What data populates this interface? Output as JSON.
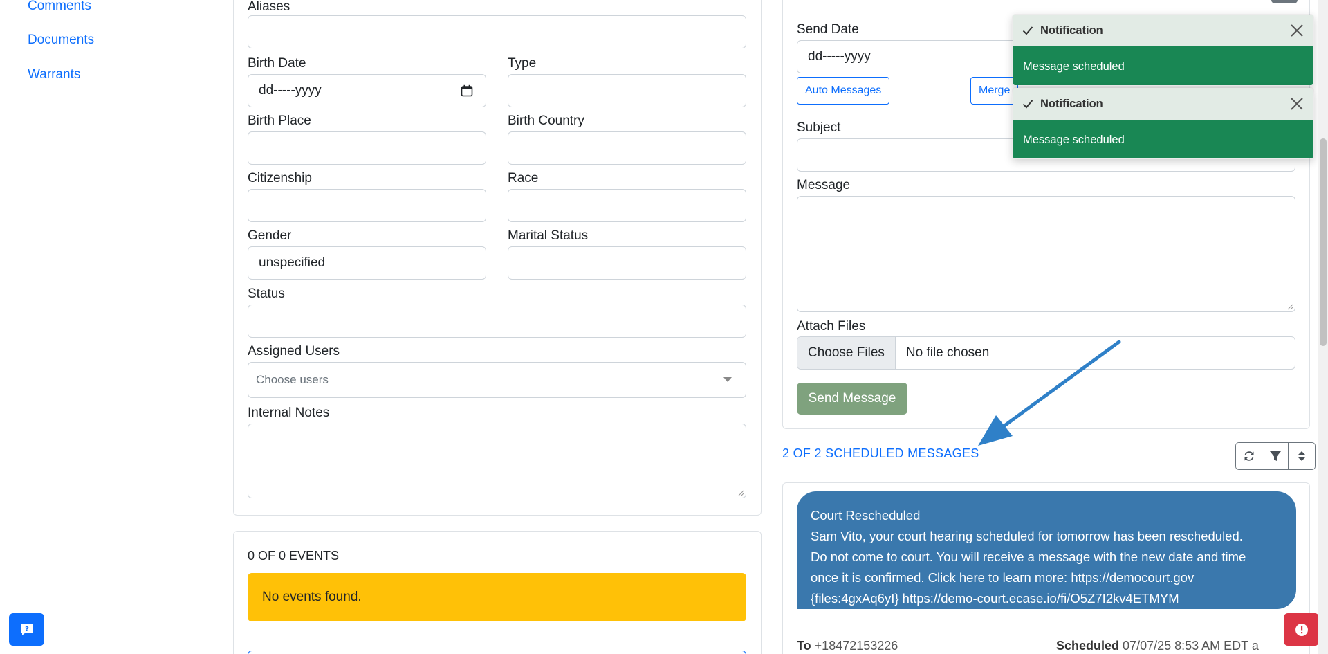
{
  "sidebar": {
    "items": [
      {
        "label": "Comments"
      },
      {
        "label": "Documents"
      },
      {
        "label": "Warrants"
      }
    ]
  },
  "profile_form": {
    "aliases": {
      "label": "Aliases",
      "value": ""
    },
    "birth_date": {
      "label": "Birth Date",
      "value": "dd-----yyyy"
    },
    "type": {
      "label": "Type",
      "value": ""
    },
    "birth_place": {
      "label": "Birth Place",
      "value": ""
    },
    "birth_country": {
      "label": "Birth Country",
      "value": ""
    },
    "citizenship": {
      "label": "Citizenship",
      "value": ""
    },
    "race": {
      "label": "Race",
      "value": ""
    },
    "gender": {
      "label": "Gender",
      "value": "unspecified"
    },
    "marital_status": {
      "label": "Marital Status",
      "value": ""
    },
    "status": {
      "label": "Status",
      "value": ""
    },
    "assigned_users": {
      "label": "Assigned Users",
      "placeholder": "Choose users"
    },
    "internal_notes": {
      "label": "Internal Notes",
      "value": ""
    }
  },
  "events": {
    "count_label": "0 OF 0 EVENTS",
    "empty_text": "No events found."
  },
  "message_form": {
    "send_date": {
      "label": "Send Date",
      "value": "dd-----yyyy"
    },
    "auto_messages_label": "Auto Messages",
    "merge_label": "Merge",
    "subject_label": "Subject",
    "message_label": "Message",
    "attach_label": "Attach Files",
    "choose_files_label": "Choose Files",
    "no_file_text": "No file chosen",
    "send_label": "Send Message"
  },
  "scheduled": {
    "count_label": "2 OF 2 SCHEDULED MESSAGES",
    "message": {
      "lines": [
        "Court Rescheduled",
        "Sam Vito, your court hearing scheduled for tomorrow has been rescheduled.",
        "Do not come to court. You will receive a message with the new date and time",
        "once it is confirmed. Click here to learn more: https://democourt.gov",
        "{files:4gxAq6yI} https://demo-court.ecase.io/fi/O5Z7I2kv4ETMYM"
      ],
      "to_label": "To",
      "to_value": "+18472153226",
      "scheduled_label": "Scheduled",
      "scheduled_value": "07/07/25 8:53 AM EDT a"
    }
  },
  "toasts": [
    {
      "title": "Notification",
      "body": "Message scheduled"
    },
    {
      "title": "Notification",
      "body": "Message scheduled"
    }
  ],
  "colors": {
    "primary": "#0d6efd",
    "success": "#198754",
    "warning": "#ffc107",
    "bubble": "#3a78ad",
    "danger": "#dc3545"
  }
}
